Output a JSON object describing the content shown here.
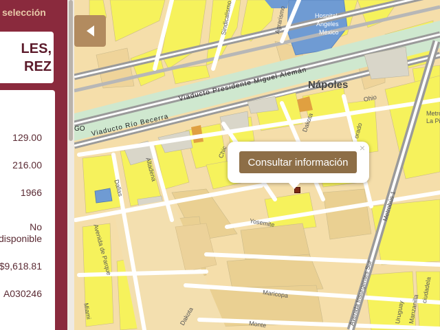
{
  "panel": {
    "title": "selección",
    "name_lines": [
      "LES,",
      "REZ"
    ],
    "values": [
      "129.00",
      "216.00",
      "1966",
      "No",
      "disponible",
      "$9,618.81",
      "A030246"
    ]
  },
  "map": {
    "popup_button": "Consultar información",
    "close_glyph": "×",
    "labels": {
      "napoles": "Nápoles",
      "viaducto_miguel_aleman": "Viaducto Presidente Miguel Alemán",
      "viaducto_rio_becerra": "Viaducto Río Becerra",
      "hospital_1": "Hospital",
      "hospital_2": "Ángeles",
      "hospital_3": "México",
      "metrobus_1": "Metrobus",
      "metrobus_2": "La Piedad",
      "ohio": "Ohio",
      "dakota": "Dakota",
      "orado": "orado",
      "chicago": "Chic",
      "dallas": "Dallas",
      "altadena": "Altadena",
      "avenida_parque": "Avenida de Parque",
      "yosemite": "Yosemite",
      "maricopa": "Maricopa",
      "montecito": "Monte",
      "miami": "Miami",
      "dakota_bottom": "Dakota",
      "insurgentes": "Avenida Insurgentes Sur",
      "metrobus_line": "Metrobús 1",
      "sindicalismo": "Sindicalismo",
      "agrarismo": "Agrarismo",
      "go": "GO",
      "uruguay": "Uruguay",
      "manzanilla": "Manzanilla",
      "ciudadela": "ciudadela"
    }
  },
  "colors": {
    "panel_bg": "#8a2a3d",
    "lot_yellow": "#f6f25c",
    "lot_tan": "#f5deaa",
    "road": "#ffffff",
    "viaduct": "#9a9a9a",
    "hospital_blue": "#6f9bd3",
    "button_brown": "#8d6e47",
    "orange_lot": "#e0a040",
    "selected_marker": "#7b2a16"
  },
  "icons": [
    "collapse-arrow-icon",
    "close-icon",
    "location-marker-icon"
  ]
}
